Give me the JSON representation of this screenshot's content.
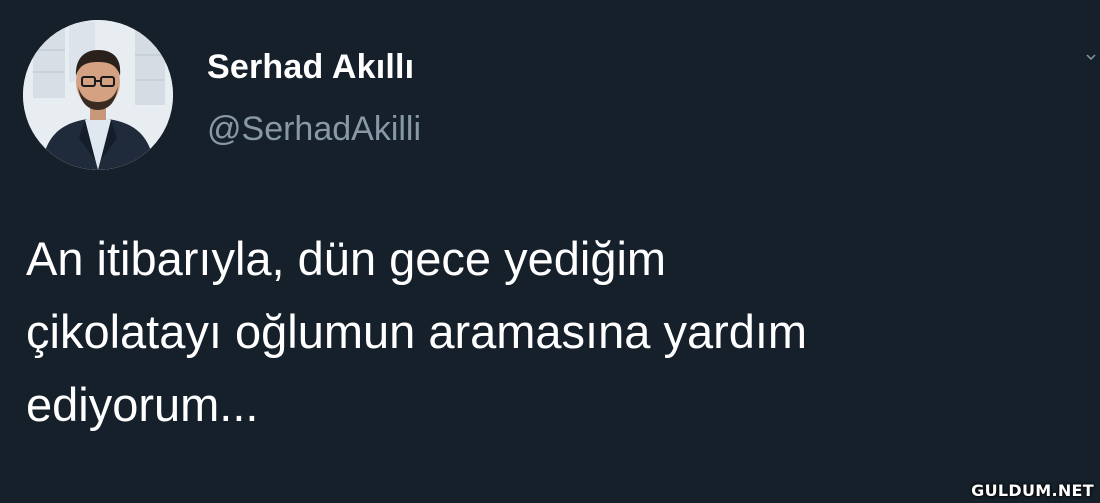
{
  "tweet": {
    "author": {
      "name": "Serhad Akıllı",
      "handle": "@SerhadAkilli",
      "avatar": "profile-photo"
    },
    "text": "An itibarıyla, dün gece yediğim\nçikolatayı oğlumun aramasına yardım\nediyorum...",
    "menu_icon": "chevron-down-icon"
  },
  "watermark": {
    "text": "GULDUM.NET"
  },
  "colors": {
    "background": "#15202b",
    "name": "#ffffff",
    "handle": "#8899a6",
    "text": "#ffffff"
  }
}
